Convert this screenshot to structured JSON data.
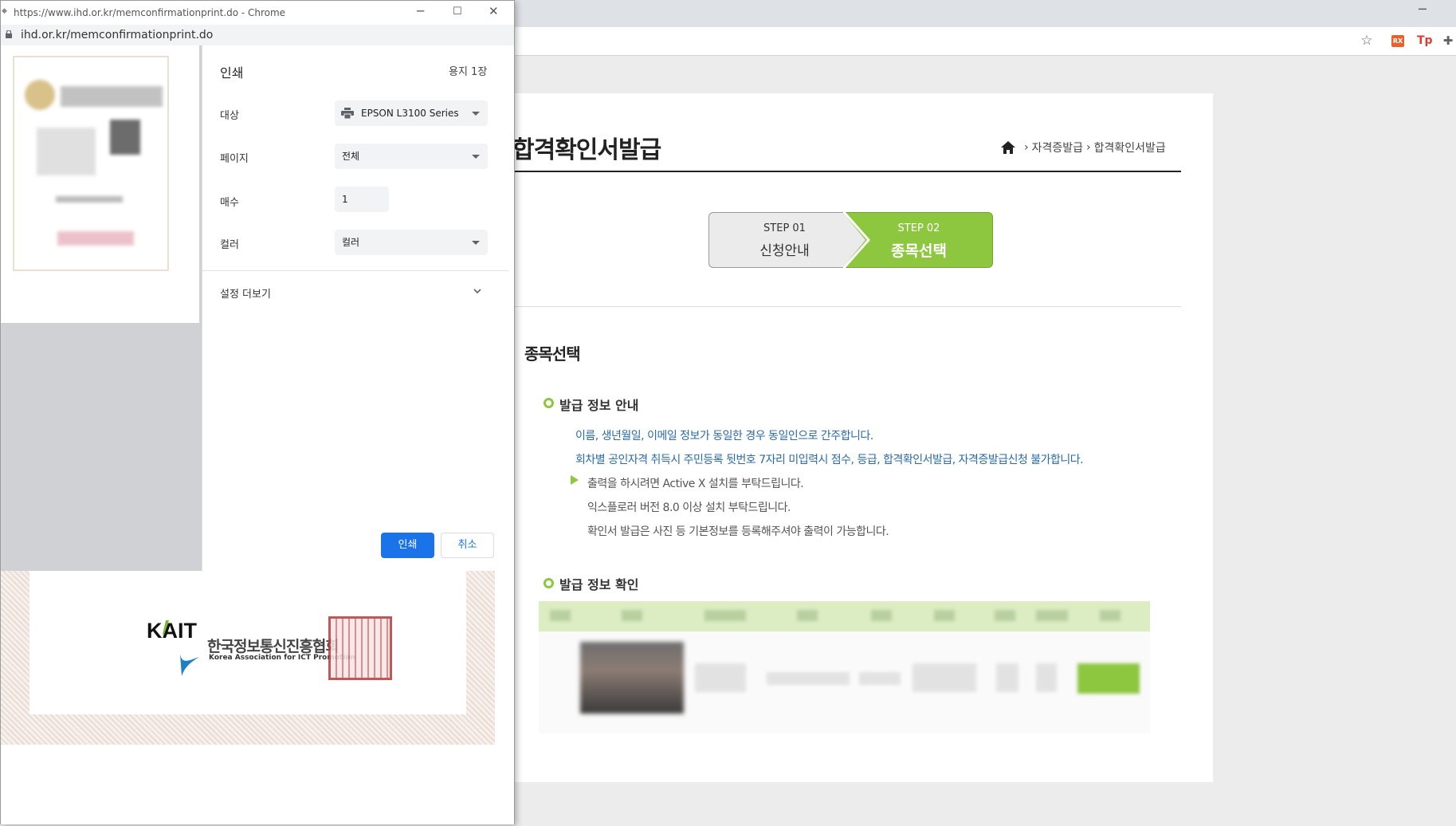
{
  "popup": {
    "window_title": "https://www.ihd.or.kr/memconfirmationprint.do - Chrome",
    "url": "ihd.or.kr/memconfirmationprint.do"
  },
  "print_dialog": {
    "heading": "인쇄",
    "sheet_count": "용지 1장",
    "destination_label": "대상",
    "destination_value": "EPSON L3100 Series",
    "pages_label": "페이지",
    "pages_value": "전체",
    "copies_label": "매수",
    "copies_value": "1",
    "color_label": "컬러",
    "color_value": "컬러",
    "more_settings_label": "설정 더보기",
    "print_button": "인쇄",
    "cancel_button": "취소"
  },
  "certificate": {
    "logo_text": "KAIT",
    "org_korean": "한국정보통신진흥협회",
    "org_english": "Korea Association for ICT Promotion"
  },
  "site": {
    "page_title": "합격확인서발급",
    "breadcrumb": [
      "자격증발급",
      "합격확인서발급"
    ],
    "steps": [
      {
        "num": "STEP 01",
        "name": "신청안내"
      },
      {
        "num": "STEP 02",
        "name": "종목선택"
      }
    ],
    "section_title": "종목선택",
    "issue_info_title": "발급 정보 안내",
    "info_lines": [
      "이름, 생년월일, 이메일 정보가 동일한 경우 동일인으로 간주합니다.",
      "회차별 공인자격 취득시 주민등록 뒷번호 7자리 미입력시 점수, 등급, 합격확인서발급, 자격증발급신청 불가합니다.",
      "출력을 하시려면 Active X 설치를 부탁드립니다.",
      "익스플로러 버전 8.0 이상 설치 부탁드립니다.",
      "확인서 발급은 사진 등 기본정보를 등록해주셔야 출력이 가능합니다."
    ],
    "issue_confirm_title": "발급 정보 확인"
  },
  "colors": {
    "accent_green": "#8dc63f",
    "info_blue": "#2b6aa8",
    "print_blue": "#1a73e8"
  }
}
